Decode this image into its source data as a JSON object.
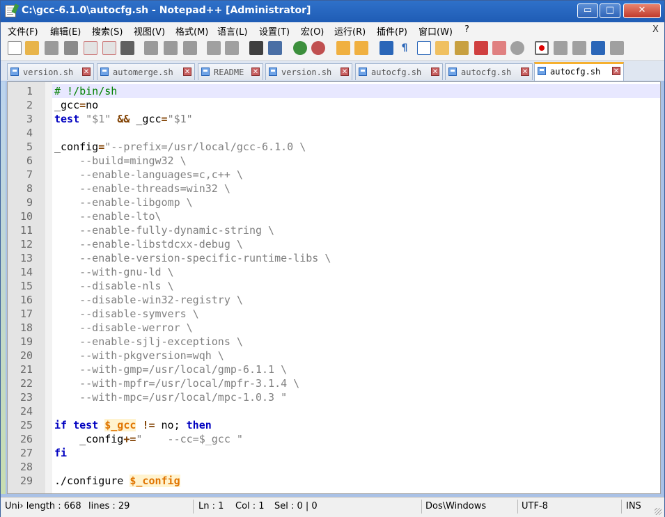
{
  "window": {
    "title": "C:\\gcc-6.1.0\\autocfg.sh - Notepad++ [Administrator]",
    "controls": {
      "minimize": "▭",
      "maximize": "□",
      "close": "✕"
    }
  },
  "menu": {
    "items": [
      "文件(F)",
      "编辑(E)",
      "搜索(S)",
      "视图(V)",
      "格式(M)",
      "语言(L)",
      "设置(T)",
      "宏(O)",
      "运行(R)",
      "插件(P)",
      "窗口(W)",
      "?"
    ],
    "close": "X"
  },
  "toolbar": {
    "icons": [
      "new-file-icon",
      "open-file-icon",
      "save-icon",
      "save-all-icon",
      "close-icon",
      "close-all-icon",
      "print-icon",
      "cut-icon",
      "copy-icon",
      "paste-icon",
      "undo-icon",
      "redo-icon",
      "find-icon",
      "replace-icon",
      "zoom-in-icon",
      "zoom-out-icon",
      "sync-vertical-icon",
      "sync-horizontal-icon",
      "word-wrap-icon",
      "show-all-chars-icon",
      "indent-guide-icon",
      "doc-map-icon",
      "function-list-icon",
      "folder-icon",
      "monitor-icon",
      "record-macro-icon",
      "stop-macro-icon",
      "play-macro-icon",
      "run-macro-multiple-icon",
      "save-macro-icon"
    ]
  },
  "tabs": [
    {
      "label": "version.sh",
      "active": false
    },
    {
      "label": "automerge.sh",
      "active": false
    },
    {
      "label": "README",
      "active": false
    },
    {
      "label": "version.sh",
      "active": false
    },
    {
      "label": "autocfg.sh",
      "active": false
    },
    {
      "label": "autocfg.sh",
      "active": false
    },
    {
      "label": "autocfg.sh",
      "active": true
    }
  ],
  "tab_close_glyph": "✕",
  "editor": {
    "current_line": 1,
    "lines": [
      [
        {
          "t": "# !/bin/sh",
          "c": "comment"
        }
      ],
      [
        {
          "t": "_gcc",
          "c": ""
        },
        {
          "t": "=",
          "c": "op"
        },
        {
          "t": "no",
          "c": ""
        }
      ],
      [
        {
          "t": "test",
          "c": "kw"
        },
        {
          "t": " ",
          "c": ""
        },
        {
          "t": "\"$1\"",
          "c": "str"
        },
        {
          "t": " ",
          "c": ""
        },
        {
          "t": "&&",
          "c": "op"
        },
        {
          "t": " _gcc",
          "c": ""
        },
        {
          "t": "=",
          "c": "op"
        },
        {
          "t": "\"$1\"",
          "c": "str"
        }
      ],
      [],
      [
        {
          "t": "_config",
          "c": ""
        },
        {
          "t": "=",
          "c": "op"
        },
        {
          "t": "\"--prefix=/usr/local/gcc-6.1.0 \\",
          "c": "str"
        }
      ],
      [
        {
          "t": "    --build=mingw32 \\",
          "c": "str"
        }
      ],
      [
        {
          "t": "    --enable-languages=c,c++ \\",
          "c": "str"
        }
      ],
      [
        {
          "t": "    --enable-threads=win32 \\",
          "c": "str"
        }
      ],
      [
        {
          "t": "    --enable-libgomp \\",
          "c": "str"
        }
      ],
      [
        {
          "t": "    --enable-lto\\",
          "c": "str"
        }
      ],
      [
        {
          "t": "    --enable-fully-dynamic-string \\",
          "c": "str"
        }
      ],
      [
        {
          "t": "    --enable-libstdcxx-debug \\",
          "c": "str"
        }
      ],
      [
        {
          "t": "    --enable-version-specific-runtime-libs \\",
          "c": "str"
        }
      ],
      [
        {
          "t": "    --with-gnu-ld \\",
          "c": "str"
        }
      ],
      [
        {
          "t": "    --disable-nls \\",
          "c": "str"
        }
      ],
      [
        {
          "t": "    --disable-win32-registry \\",
          "c": "str"
        }
      ],
      [
        {
          "t": "    --disable-symvers \\",
          "c": "str"
        }
      ],
      [
        {
          "t": "    --disable-werror \\",
          "c": "str"
        }
      ],
      [
        {
          "t": "    --enable-sjlj-exceptions \\",
          "c": "str"
        }
      ],
      [
        {
          "t": "    --with-pkgversion=wqh \\",
          "c": "str"
        }
      ],
      [
        {
          "t": "    --with-gmp=/usr/local/gmp-6.1.1 \\",
          "c": "str"
        }
      ],
      [
        {
          "t": "    --with-mpfr=/usr/local/mpfr-3.1.4 \\",
          "c": "str"
        }
      ],
      [
        {
          "t": "    --with-mpc=/usr/local/mpc-1.0.3 \"",
          "c": "str"
        }
      ],
      [],
      [
        {
          "t": "if",
          "c": "kw"
        },
        {
          "t": " ",
          "c": ""
        },
        {
          "t": "test",
          "c": "kw"
        },
        {
          "t": " ",
          "c": ""
        },
        {
          "t": "$_gcc",
          "c": "var"
        },
        {
          "t": " ",
          "c": ""
        },
        {
          "t": "!=",
          "c": "op"
        },
        {
          "t": " no; ",
          "c": ""
        },
        {
          "t": "then",
          "c": "kw"
        }
      ],
      [
        {
          "t": "    _config",
          "c": ""
        },
        {
          "t": "+=",
          "c": "op"
        },
        {
          "t": "\"    --cc=$_gcc \"",
          "c": "str"
        }
      ],
      [
        {
          "t": "fi",
          "c": "kw"
        }
      ],
      [],
      [
        {
          "t": "./configure ",
          "c": ""
        },
        {
          "t": "$_config",
          "c": "var"
        }
      ]
    ]
  },
  "status": {
    "filetype": "Uni› length : 668",
    "lines": "lines : 29",
    "ln": "Ln : 1",
    "col": "Col : 1",
    "sel": "Sel : 0 | 0",
    "eol": "Dos\\Windows",
    "encoding": "UTF-8",
    "mode": "INS"
  }
}
